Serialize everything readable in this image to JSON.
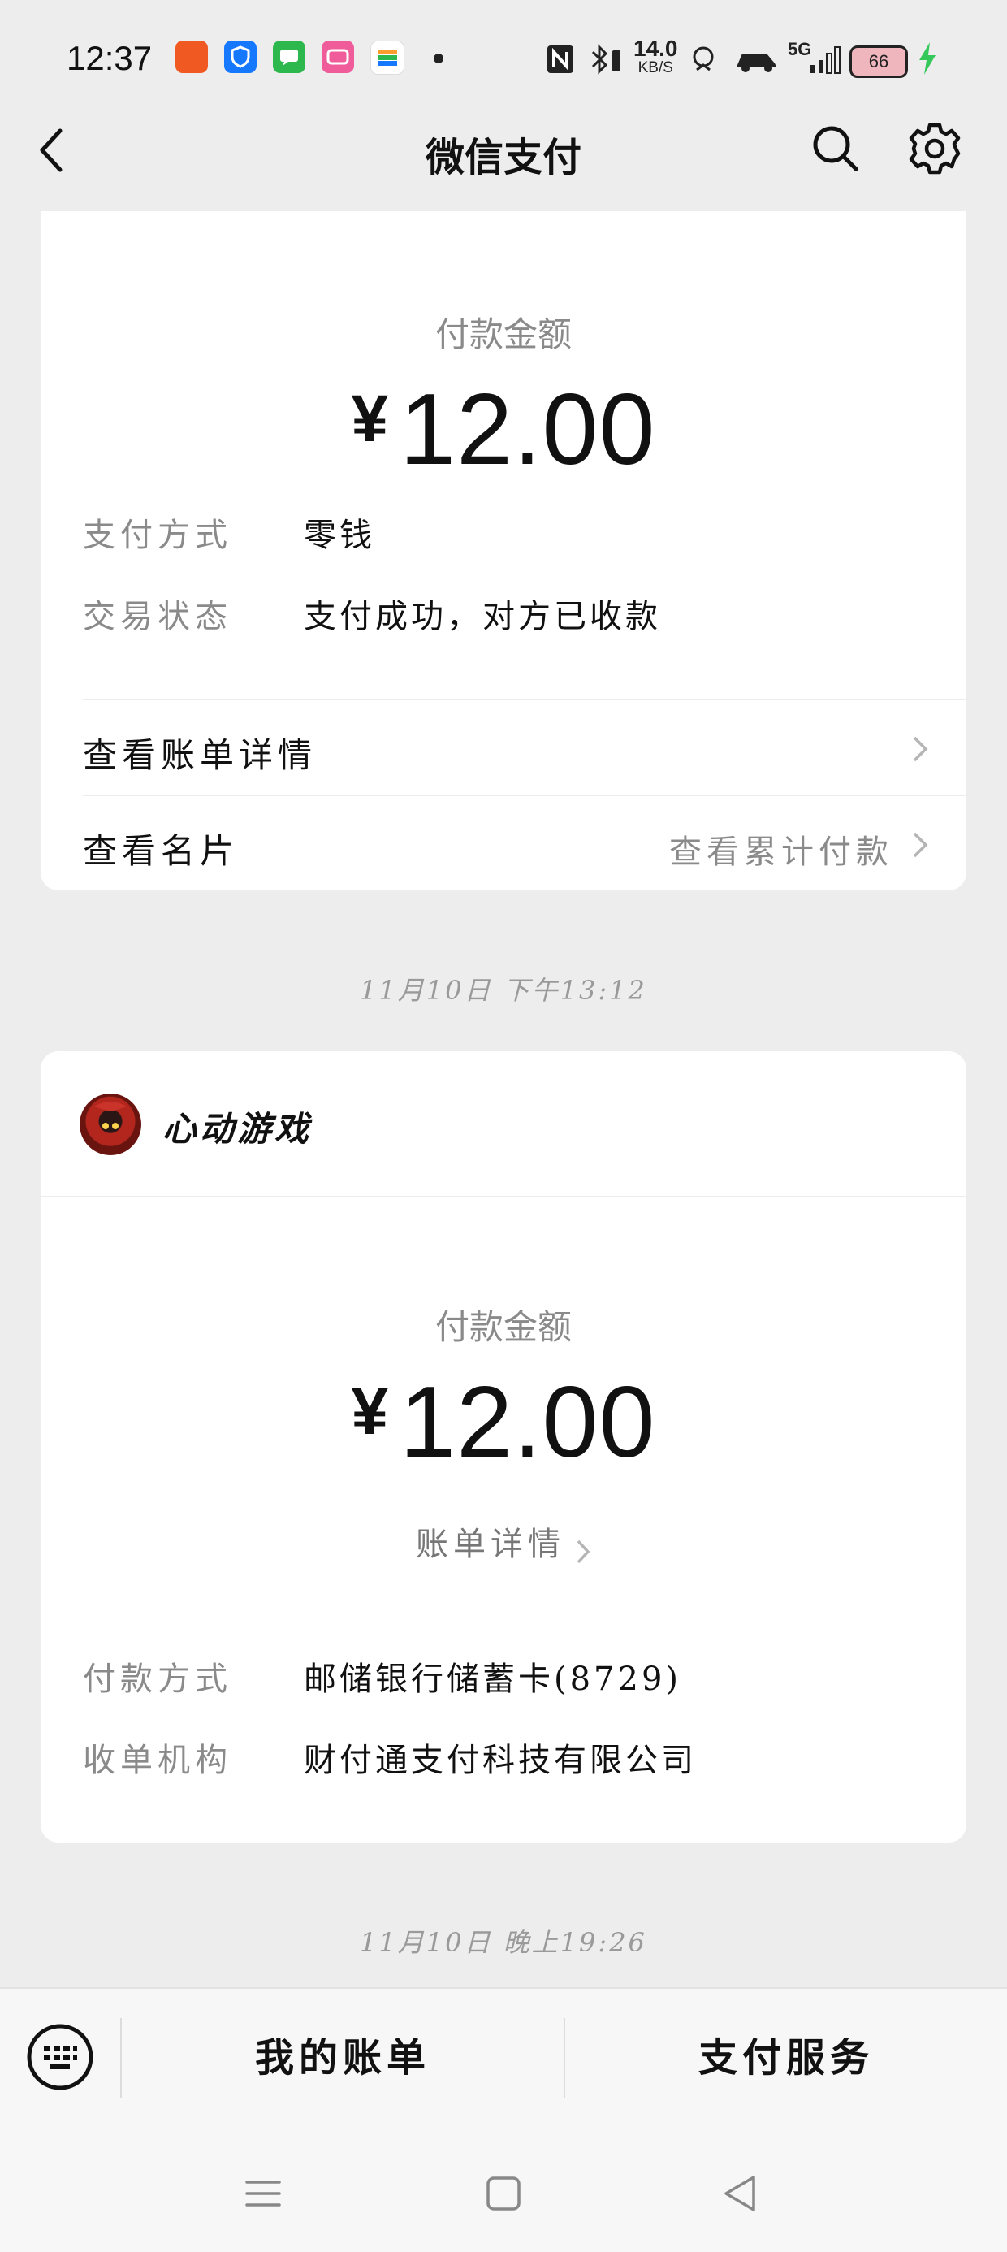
{
  "status_bar": {
    "time": "12:37",
    "net_speed_value": "14.0",
    "net_speed_unit": "KB/S",
    "network": "5G",
    "battery": "66",
    "app_icons": [
      "fire-app-icon",
      "shield-app-icon",
      "message-app-icon",
      "bilibili-app-icon",
      "wallet-app-icon"
    ],
    "colors": {
      "app1": "#f05a22",
      "app2": "#1677ff",
      "app3": "#2db84d",
      "app4": "#f05b9a",
      "app5": "#ff9e2c",
      "charging": "#34c759"
    }
  },
  "nav": {
    "title": "微信支付"
  },
  "card1": {
    "amount_label": "付款金额",
    "currency": "¥",
    "amount": "12.00",
    "details": [
      {
        "key": "支付方式",
        "value": "零钱"
      },
      {
        "key": "交易状态",
        "value": "支付成功，对方已收款"
      }
    ],
    "rows": [
      {
        "label": "查看账单详情",
        "right": ""
      },
      {
        "label": "查看名片",
        "right": "查看累计付款"
      }
    ]
  },
  "date1": "11月10日 下午13:12",
  "card2": {
    "merchant": "心动游戏",
    "amount_label": "付款金额",
    "currency": "¥",
    "amount": "12.00",
    "bill_link": "账单详情",
    "details": [
      {
        "key": "付款方式",
        "value": "邮储银行储蓄卡(8729)"
      },
      {
        "key": "收单机构",
        "value": "财付通支付科技有限公司"
      }
    ]
  },
  "date2": "11月10日 晚上19:26",
  "bottom_bar": {
    "my_bill": "我的账单",
    "pay_service": "支付服务"
  }
}
